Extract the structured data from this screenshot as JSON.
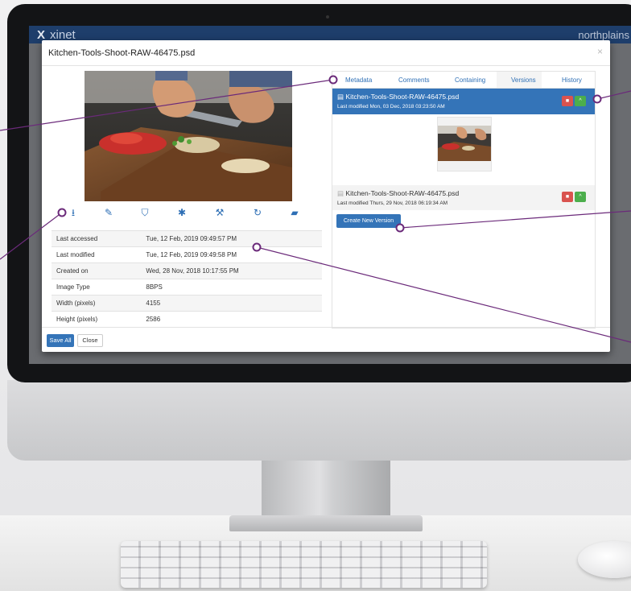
{
  "app": {
    "brand_mark": "X",
    "brand_name": "xinet",
    "vendor": "northplains"
  },
  "modal": {
    "title": "Kitchen-Tools-Shoot-RAW-46475.psd",
    "close_glyph": "×"
  },
  "toolbar": {
    "icons": [
      "download-icon",
      "edit-icon",
      "basket-icon",
      "settings-icon",
      "wrench-icon",
      "refresh-icon",
      "folder-icon"
    ]
  },
  "metadata": {
    "rows": [
      {
        "label": "Last accessed",
        "value": "Tue, 12 Feb, 2019 09:49:57 PM"
      },
      {
        "label": "Last modified",
        "value": "Tue, 12 Feb, 2019 09:49:58 PM"
      },
      {
        "label": "Created on",
        "value": "Wed, 28 Nov, 2018 10:17:55 PM"
      },
      {
        "label": "Image Type",
        "value": "8BPS"
      },
      {
        "label": "Width (pixels)",
        "value": "4155"
      },
      {
        "label": "Height (pixels)",
        "value": "2586"
      }
    ]
  },
  "tabs": [
    "Metadata",
    "Comments",
    "Containing",
    "Versions",
    "History"
  ],
  "versions": [
    {
      "name": "Kitchen-Tools-Shoot-RAW-46475.psd",
      "modified": "Last modified Mon, 03 Dec, 2018 03:23:50 AM"
    },
    {
      "name": "Kitchen-Tools-Shoot-RAW-46475.psd",
      "modified": "Last modified Thurs, 29 Nov, 2018 06:19:34 AM"
    }
  ],
  "buttons": {
    "create_version": "Create New Version",
    "save_all": "Save All",
    "close": "Close"
  },
  "colors": {
    "accent": "#3474b8",
    "appbar": "#1e3e6b",
    "danger": "#d9534f",
    "success": "#4cae4c",
    "callout": "#6b2a7a"
  }
}
